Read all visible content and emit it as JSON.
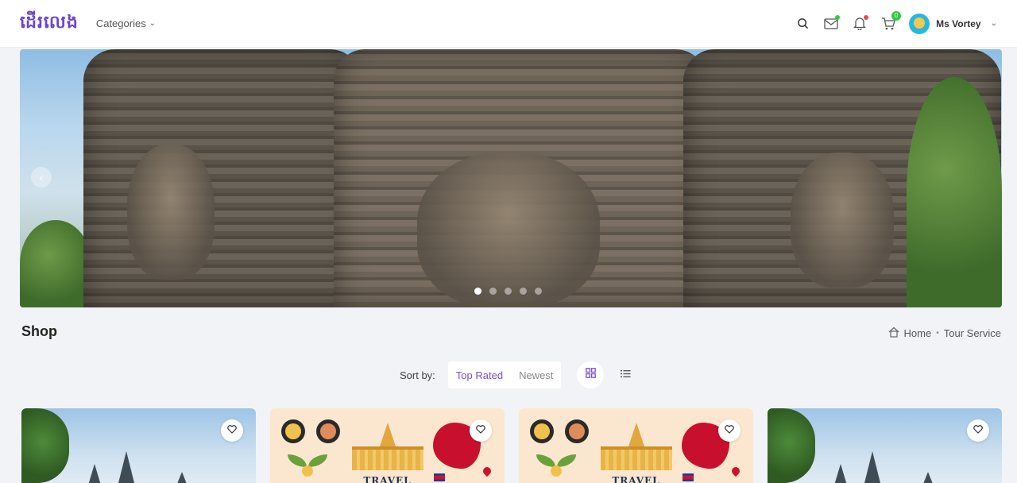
{
  "header": {
    "logo_text": "ដើរលេង",
    "categories_label": "Categories",
    "cart_count": "0",
    "user_name": "Ms Vortey",
    "icons": [
      "search-icon",
      "mail-icon",
      "bell-icon",
      "cart-icon",
      "chevron-down-icon"
    ]
  },
  "banner": {
    "slide_count": 5,
    "active_slide": 1,
    "prev_icon": "chevron-left-icon"
  },
  "shop": {
    "title": "Shop",
    "breadcrumb": {
      "home": "Home",
      "current": "Tour Service"
    }
  },
  "sort": {
    "label": "Sort by:",
    "options": [
      "Top Rated",
      "Newest"
    ],
    "active": "Top Rated",
    "view_modes": [
      "grid-view-icon",
      "list-view-icon"
    ]
  },
  "cards": [
    {
      "type": "photo",
      "favorite_icon": "heart-icon"
    },
    {
      "type": "poster",
      "poster_title": "TRAVEL",
      "favorite_icon": "heart-icon"
    },
    {
      "type": "poster",
      "poster_title": "TRAVEL",
      "favorite_icon": "heart-icon"
    },
    {
      "type": "photo",
      "favorite_icon": "heart-icon"
    }
  ],
  "colors": {
    "accent": "#7c4ddb",
    "logo": "#6a45d6",
    "badge": "#2ecc40",
    "page_bg": "#f2f3f7"
  }
}
